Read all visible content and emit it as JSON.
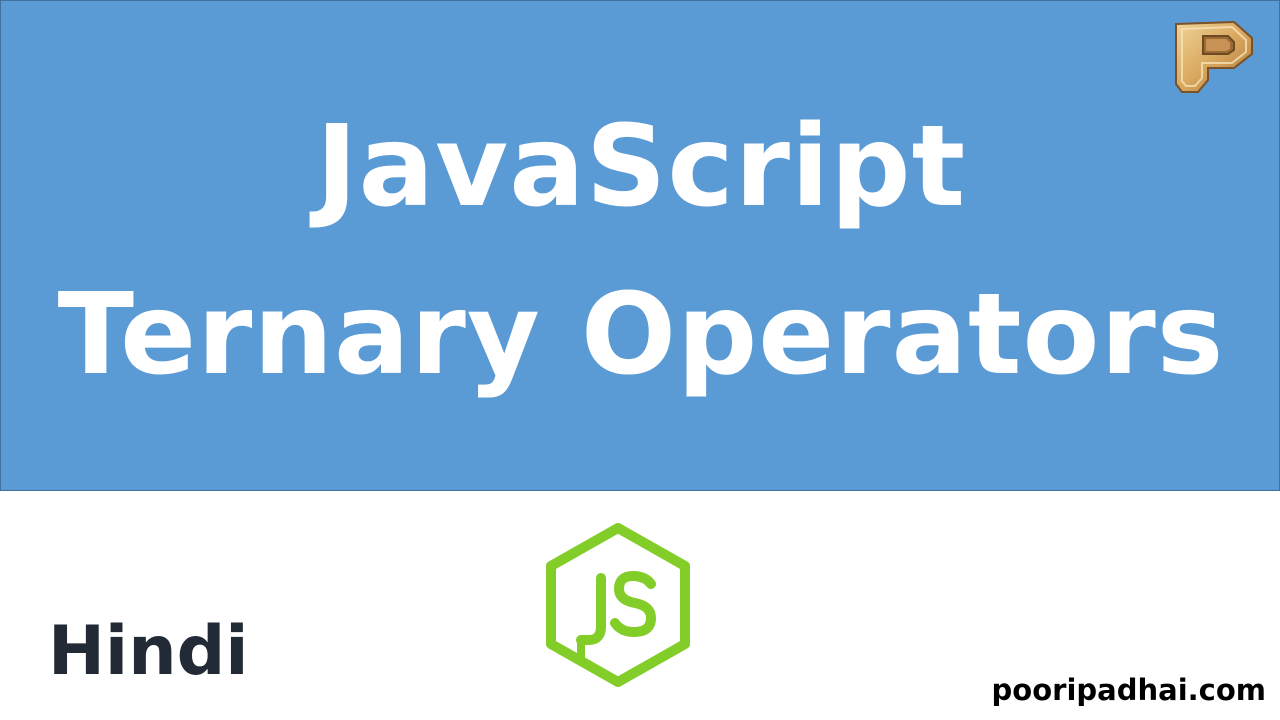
{
  "banner": {
    "title_line1": "JavaScript",
    "title_line2": "Ternary Operators",
    "background_color": "#5b9bd5",
    "text_color": "#ffffff"
  },
  "brand_logo": {
    "icon": "letter-p-logo-icon",
    "letter": "P"
  },
  "language_label": "Hindi",
  "js_logo": {
    "icon": "nodejs-hexagon-icon",
    "text": "JS",
    "color": "#83cd29"
  },
  "website": "pooripadhai.com"
}
